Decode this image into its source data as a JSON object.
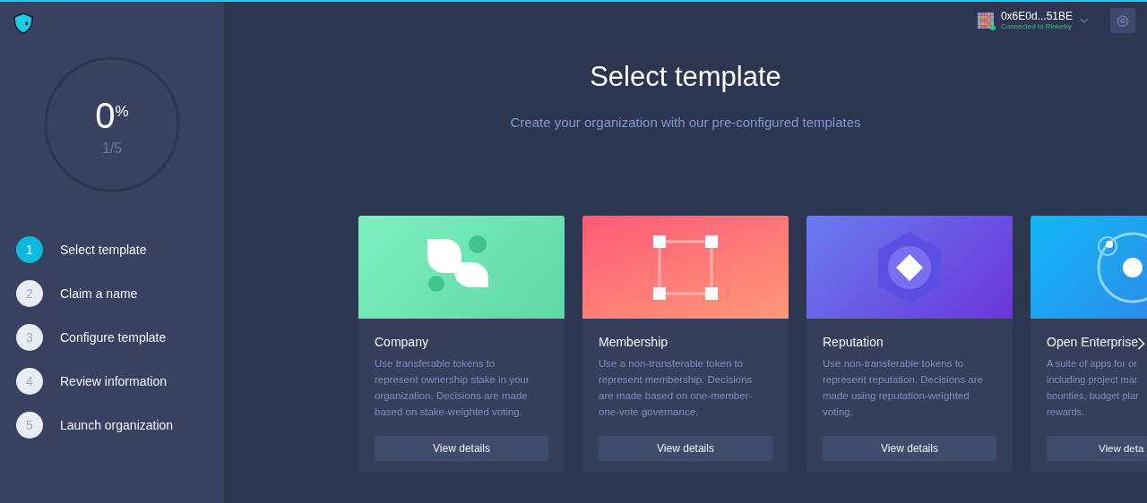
{
  "progress": {
    "percent": "0",
    "unit": "%",
    "fraction": "1/5"
  },
  "steps": [
    {
      "number": "1",
      "label": "Select template",
      "selected": true
    },
    {
      "number": "2",
      "label": "Claim a name",
      "selected": false
    },
    {
      "number": "3",
      "label": "Configure template",
      "selected": false
    },
    {
      "number": "4",
      "label": "Review information",
      "selected": false
    },
    {
      "number": "5",
      "label": "Launch organization",
      "selected": false
    }
  ],
  "account": {
    "address": "0x6E0d...51BE",
    "network": "Connected to Rinkeby",
    "connected": true
  },
  "heading": "Select template",
  "subheading": "Create your organization with our pre-configured templates",
  "templates": [
    {
      "kind": "company",
      "name": "Company",
      "description": "Use transferable tokens to\nrepresent ownership stake in your\norganization. Decisions are made\nbased on stake-weighted voting.",
      "button": "View details"
    },
    {
      "kind": "membership",
      "name": "Membership",
      "description": "Use a non-transferable token to\nrepresent membership. Decisions\nare made based on one-member-\none-vote governance.",
      "button": "View details"
    },
    {
      "kind": "reputation",
      "name": "Reputation",
      "description": "Use non-transferable tokens to\nrepresent reputation. Decisions are\nmade using reputation-weighted\nvoting.",
      "button": "View details"
    },
    {
      "kind": "enterprise",
      "name": "Open Enterprise",
      "description": "A suite of apps for or\nincluding project mar\nbounties, budget plar\nrewards.",
      "button": "View deta"
    }
  ]
}
